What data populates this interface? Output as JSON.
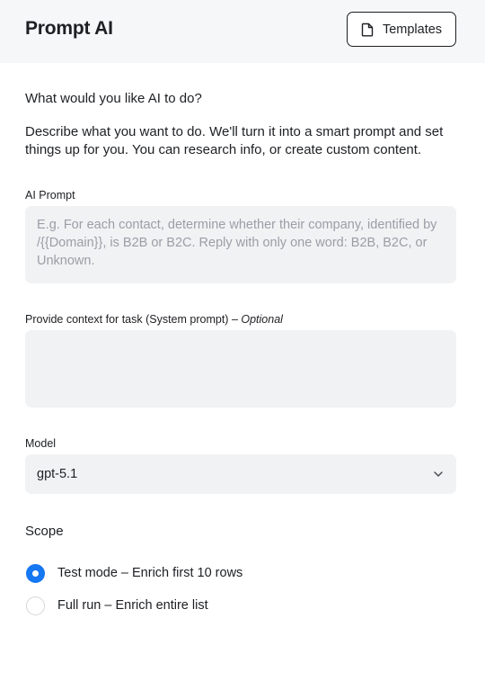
{
  "header": {
    "title": "Prompt AI",
    "templates_button": "Templates"
  },
  "intro": {
    "question": "What would you like AI to do?",
    "description": "Describe what you want to do. We'll turn it into a smart prompt and set things up for you. You can research info, or create custom content."
  },
  "ai_prompt": {
    "label": "AI Prompt",
    "value": "",
    "placeholder": "E.g. For each contact, determine whether their company, identified by /{{Domain}}, is B2B or B2C. Reply with only one word: B2B, B2C, or Unknown."
  },
  "system_prompt": {
    "label": "Provide context for task (System prompt) –",
    "optional": "Optional",
    "value": "",
    "placeholder": ""
  },
  "model": {
    "label": "Model",
    "selected": "gpt-5.1"
  },
  "scope": {
    "title": "Scope",
    "options": [
      {
        "label": "Test mode – Enrich first 10 rows",
        "selected": true
      },
      {
        "label": "Full run – Enrich entire list",
        "selected": false
      }
    ]
  },
  "colors": {
    "accent": "#1677f2",
    "header_bg": "#f6f7f9",
    "field_bg": "#f1f2f4"
  }
}
